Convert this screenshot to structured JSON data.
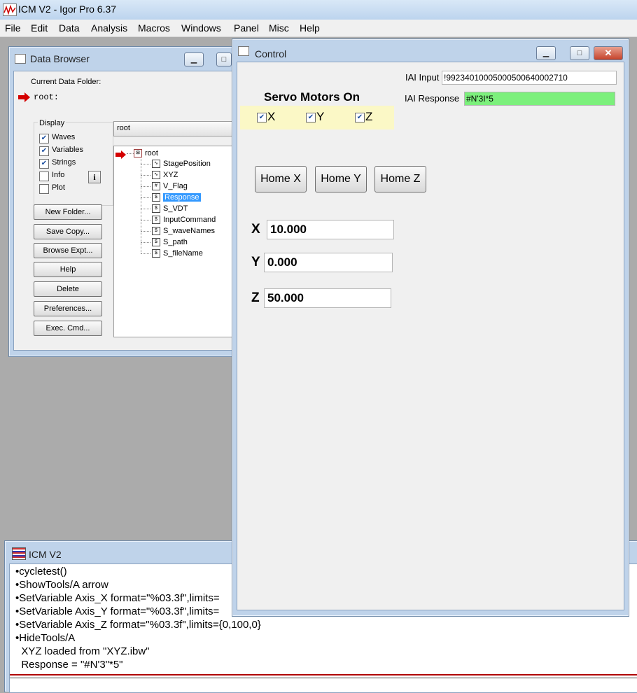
{
  "app": {
    "title": "ICM V2 - Igor Pro 6.37"
  },
  "menu": [
    "File",
    "Edit",
    "Data",
    "Analysis",
    "Macros",
    "Windows",
    "Panel",
    "Misc",
    "Help"
  ],
  "data_browser": {
    "title": "Data Browser",
    "current_folder_label": "Current Data Folder:",
    "current_folder_value": "root:",
    "display_label": "Display",
    "checks": [
      {
        "label": "Waves",
        "checked": true
      },
      {
        "label": "Variables",
        "checked": true
      },
      {
        "label": "Strings",
        "checked": true
      },
      {
        "label": "Info",
        "checked": false
      },
      {
        "label": "Plot",
        "checked": false
      }
    ],
    "info_button": "i",
    "folder_select": "root",
    "buttons": [
      "New Folder...",
      "Save Copy...",
      "Browse Expt...",
      "Help",
      "Delete",
      "Preferences...",
      "Exec. Cmd..."
    ],
    "tree_root": "root",
    "tree_items": [
      "StagePosition",
      "XYZ",
      "V_Flag",
      "Response",
      "S_VDT",
      "InputCommand",
      "S_waveNames",
      "S_path",
      "S_fileName"
    ],
    "selected_item": "Response"
  },
  "control": {
    "title": "Control",
    "iai_input_label": "IAI Input",
    "iai_input_value": "!99234010005000500640002710",
    "iai_response_label": "IAI Response",
    "iai_response_value": "#N'3I*5",
    "servo_title": "Servo Motors On",
    "servo": [
      {
        "label": "X",
        "checked": true
      },
      {
        "label": "Y",
        "checked": true
      },
      {
        "label": "Z",
        "checked": true
      }
    ],
    "home_buttons": [
      "Home X",
      "Home Y",
      "Home Z"
    ],
    "axes": [
      {
        "label": "X",
        "value": "10.000"
      },
      {
        "label": "Y",
        "value": "0.000"
      },
      {
        "label": "Z",
        "value": "50.000"
      }
    ]
  },
  "command_window": {
    "title": "ICM V2",
    "lines": [
      "•cycletest()",
      "•ShowTools/A arrow",
      "•SetVariable Axis_X format=\"%03.3f\",limits=",
      "•SetVariable Axis_Y format=\"%03.3f\",limits=",
      "•SetVariable Axis_Z format=\"%03.3f\",limits={0,100,0}",
      "•HideTools/A",
      "  XYZ loaded from \"XYZ.ibw\"",
      "  Response = \"#N'3\"*5\""
    ]
  },
  "colors": {
    "response_bg": "#7cf07c",
    "servo_panel_bg": "#fbf8c6",
    "selection": "#3399ff",
    "arrow": "#d40000"
  }
}
